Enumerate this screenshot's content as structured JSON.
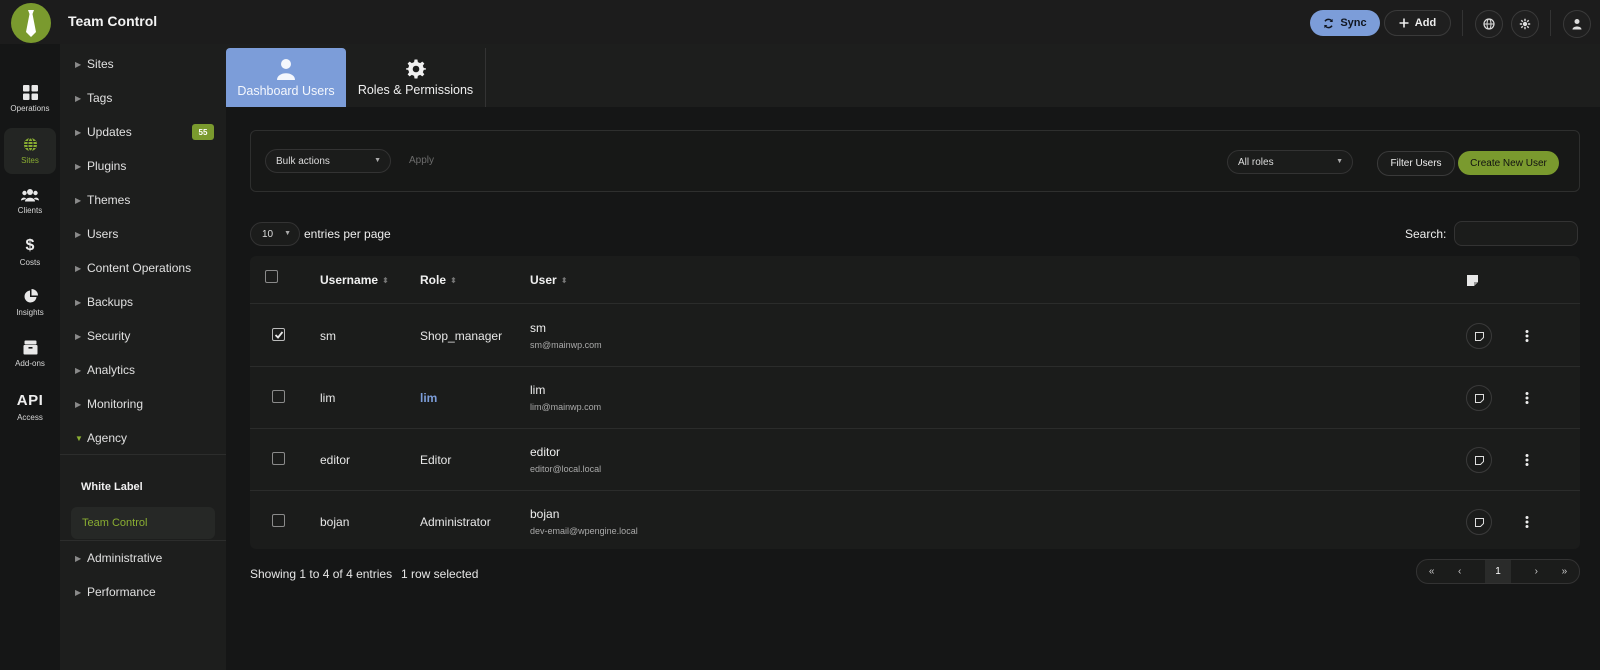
{
  "app": {
    "title": "Team Control"
  },
  "header": {
    "sync_label": "Sync",
    "add_label": "Add"
  },
  "rail": {
    "operations": "Operations",
    "sites": "Sites",
    "clients": "Clients",
    "costs": "Costs",
    "insights": "Insights",
    "addons": "Add-ons",
    "api_glyph": "API",
    "access": "Access"
  },
  "sidebar": {
    "sites": "Sites",
    "tags": "Tags",
    "updates": "Updates",
    "updates_badge": "55",
    "plugins": "Plugins",
    "themes": "Themes",
    "users": "Users",
    "content_operations": "Content Operations",
    "backups": "Backups",
    "security": "Security",
    "analytics": "Analytics",
    "monitoring": "Monitoring",
    "agency": "Agency",
    "white_label": "White Label",
    "team_control": "Team Control",
    "administrative": "Administrative",
    "performance": "Performance"
  },
  "tabs": {
    "dashboard_users": "Dashboard Users",
    "roles_permissions": "Roles & Permissions"
  },
  "actions": {
    "bulk_actions": "Bulk actions",
    "apply": "Apply",
    "all_roles": "All roles",
    "filter_users": "Filter Users",
    "create_new_user": "Create New User"
  },
  "table_controls": {
    "page_length": "10",
    "entries_label": "entries per page",
    "search_label": "Search:"
  },
  "table": {
    "headers": {
      "username": "Username",
      "role": "Role",
      "user": "User"
    },
    "rows": [
      {
        "username": "sm",
        "role": "Shop_manager",
        "name": "sm",
        "email": "sm@mainwp.com",
        "checked": true
      },
      {
        "username": "lim",
        "role": "lim",
        "name": "lim",
        "email": "lim@mainwp.com",
        "checked": false
      },
      {
        "username": "editor",
        "role": "Editor",
        "name": "editor",
        "email": "editor@local.local",
        "checked": false
      },
      {
        "username": "bojan",
        "role": "Administrator",
        "name": "bojan",
        "email": "dev-email@wpengine.local",
        "checked": false
      }
    ]
  },
  "footer": {
    "showing": "Showing 1 to 4 of 4 entries",
    "selected": "1 row selected",
    "pager": {
      "first": "«",
      "prev": "‹",
      "current": "1",
      "next": "›",
      "last": "»"
    }
  }
}
